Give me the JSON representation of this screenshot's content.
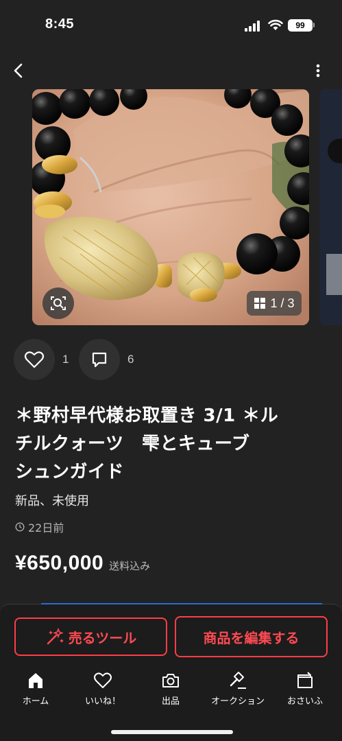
{
  "status_bar": {
    "time": "8:45",
    "battery": "99"
  },
  "nav": {
    "back_icon": "chevron-left-icon",
    "more_icon": "more-vertical-icon"
  },
  "gallery": {
    "counter": "1 / 3",
    "lens_icon": "image-search-icon",
    "grid_icon": "grid-icon"
  },
  "actions": {
    "like_count": "1",
    "comment_count": "6"
  },
  "item": {
    "title_lines": [
      "＊野村早代様お取置き 3/1 ＊ル",
      "チルクォーツ　雫とキューブ",
      "シュンガイド"
    ],
    "condition": "新品、未使用",
    "posted": "22日前",
    "price": "¥650,000",
    "shipping": "送料込み"
  },
  "buttons": {
    "sell_tool": "売るツール",
    "edit": "商品を編集する"
  },
  "tabbar": {
    "items": [
      {
        "label": "ホーム",
        "icon": "home-icon"
      },
      {
        "label": "いいね！",
        "icon": "heart-icon"
      },
      {
        "label": "出品",
        "icon": "camera-icon"
      },
      {
        "label": "オークション",
        "icon": "gavel-icon"
      },
      {
        "label": "おさいふ",
        "icon": "wallet-icon"
      }
    ]
  },
  "colors": {
    "background": "#222222",
    "accent_red": "#ff4a52",
    "bottom_sheet": "#1c1c1c"
  }
}
